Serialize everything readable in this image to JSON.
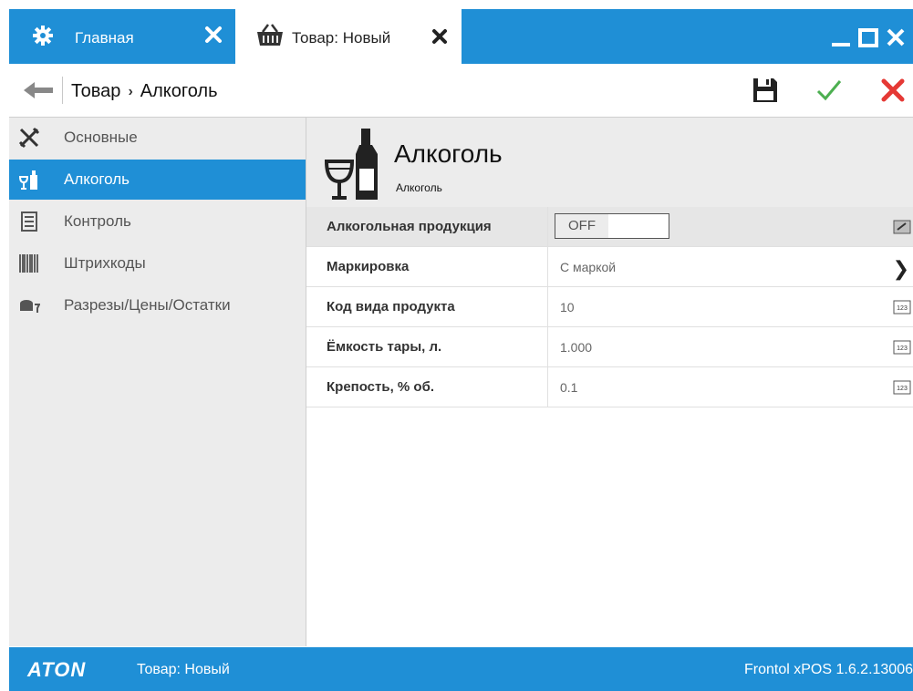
{
  "tabs": {
    "home": {
      "label": "Главная"
    },
    "item": {
      "label": "Товар: Новый"
    }
  },
  "nav": {
    "breadcrumb_root": "Товар",
    "breadcrumb_separator": "›",
    "breadcrumb_current": "Алкоголь"
  },
  "sidebar": {
    "items": [
      {
        "label": "Основные",
        "icon": "tools-icon"
      },
      {
        "label": "Алкоголь",
        "icon": "wine-bottle-icon"
      },
      {
        "label": "Контроль",
        "icon": "checklist-icon"
      },
      {
        "label": "Штрихкоды",
        "icon": "barcode-icon"
      },
      {
        "label": "Разрезы/Цены/Остатки",
        "icon": "stock-icon"
      }
    ]
  },
  "header": {
    "title": "Алкоголь",
    "subtitle": "Алкоголь"
  },
  "properties": [
    {
      "label": "Алкогольная продукция",
      "toggle_label": "OFF"
    },
    {
      "label": "Маркировка",
      "value": "С маркой"
    },
    {
      "label": "Код вида продукта",
      "value": "10"
    },
    {
      "label": "Ёмкость тары, л.",
      "value": "1.000"
    },
    {
      "label": "Крепость, % об.",
      "value": "0.1"
    }
  ],
  "status": {
    "logo": "ATON",
    "text": "Товар: Новый",
    "version": "Frontol xPOS 1.6.2.13006"
  },
  "colors": {
    "accent": "#1f8fd6",
    "save": "#222222",
    "confirm": "#4caf50",
    "cancel": "#e53935"
  }
}
